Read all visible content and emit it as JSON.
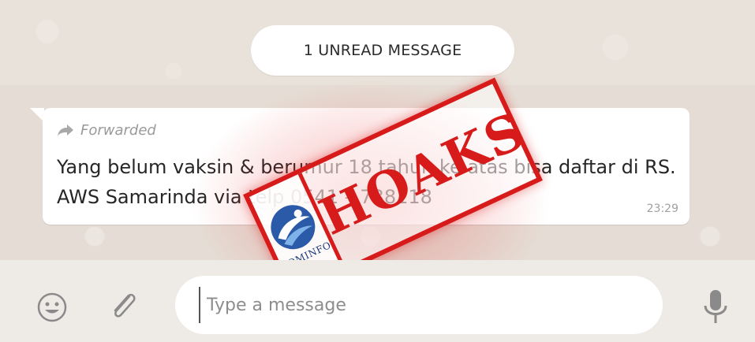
{
  "chat": {
    "unread_label": "1 UNREAD MESSAGE",
    "message": {
      "forwarded_label": "Forwarded",
      "text": "Yang belum vaksin & berumur 18 tahun ke atas bisa daftar di RS. AWS Samarinda via telp 0541 – 738118",
      "time": "23:29"
    }
  },
  "composer": {
    "placeholder": "Type a message",
    "emoji_icon": "emoji-icon",
    "attach_icon": "paperclip-icon",
    "mic_icon": "microphone-icon"
  },
  "stamp": {
    "word": "HOAKS",
    "logo_text": "KOMINFO",
    "color": "#d71a1a"
  },
  "colors": {
    "chat_background": "#e5ddd5",
    "bubble": "#ffffff",
    "footer": "#eeeae6"
  }
}
